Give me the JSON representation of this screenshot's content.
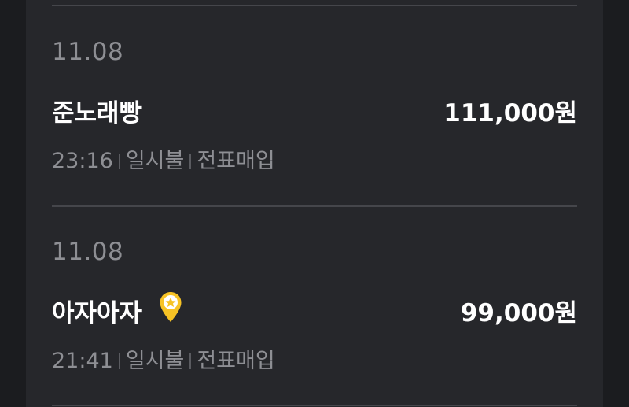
{
  "transactions": [
    {
      "date": "11.08",
      "merchant": "준노래빵",
      "amount": "111,000원",
      "time": "23:16",
      "payment_type": "일시불",
      "status": "전표매입",
      "has_pin": false
    },
    {
      "date": "11.08",
      "merchant": "아자아자",
      "amount": "99,000원",
      "time": "21:41",
      "payment_type": "일시불",
      "status": "전표매입",
      "has_pin": true,
      "pin_icon": "star-location-pin-icon"
    }
  ],
  "colors": {
    "background": "#1b1c1f",
    "panel": "#26272b",
    "divider": "#45464b",
    "primary_text": "#ffffff",
    "secondary_text": "#8e8f94",
    "pin_yellow": "#f7c325"
  }
}
